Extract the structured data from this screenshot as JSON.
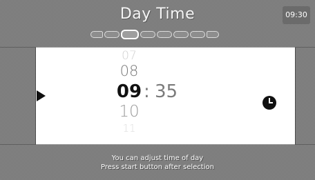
{
  "header": {
    "title": "Day Time",
    "clock": "09:30",
    "steps": {
      "total": 8,
      "active_index": 2
    }
  },
  "picker": {
    "hours_above": [
      "07",
      "08"
    ],
    "selected_hour": "09",
    "separator": ":",
    "selected_minute": "35",
    "hours_below": [
      "10",
      "11"
    ]
  },
  "icons": {
    "left_arrow": "play-left-arrow-icon",
    "clock": "clock-icon"
  },
  "footer": {
    "line1": "You can adjust time of day",
    "line2": "Press start button after selection"
  },
  "colors": {
    "background": "#8e8e8e",
    "panel": "#ffffff",
    "selected_text": "#111111"
  }
}
